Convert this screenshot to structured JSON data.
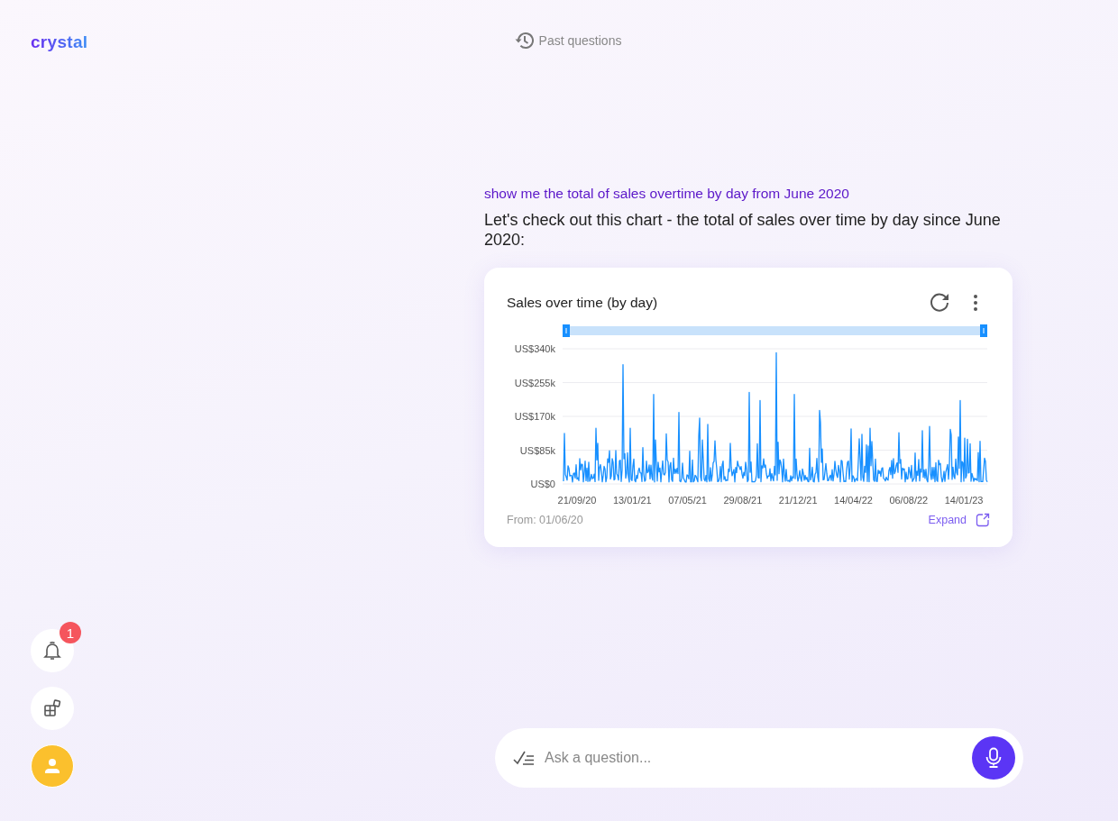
{
  "app": {
    "logo": "crystal"
  },
  "header": {
    "past_questions": "Past questions"
  },
  "conversation": {
    "question": "show me the total of sales overtime by day from June 2020",
    "answer": "Let's check out this chart - the total of sales over time by day since June 2020:",
    "card": {
      "title": "Sales over time (by day)",
      "chart": {
        "kind": "picture",
        "range_handles": [
          {
            "level": 0
          },
          {
            "level": 1
          }
        ],
        "y_axis_labels": [
          "US$340k",
          "US$255k",
          "US$170k",
          "US$85k",
          "US$0"
        ],
        "x_axis_labels": [
          "21/09/20",
          "13/01/21",
          "07/05/21",
          "29/08/21",
          "21/12/21",
          "14/04/22",
          "06/08/22",
          "14/01/23"
        ]
      },
      "from": "From: 01/06/20",
      "expand": "Expand"
    }
  },
  "sidebar": {
    "buttons": [
      {
        "kind": "notifications",
        "badge": "1"
      },
      {
        "kind": "apps"
      },
      {
        "kind": "profile"
      }
    ]
  },
  "input": {
    "placeholder": "Ask a question..."
  }
}
